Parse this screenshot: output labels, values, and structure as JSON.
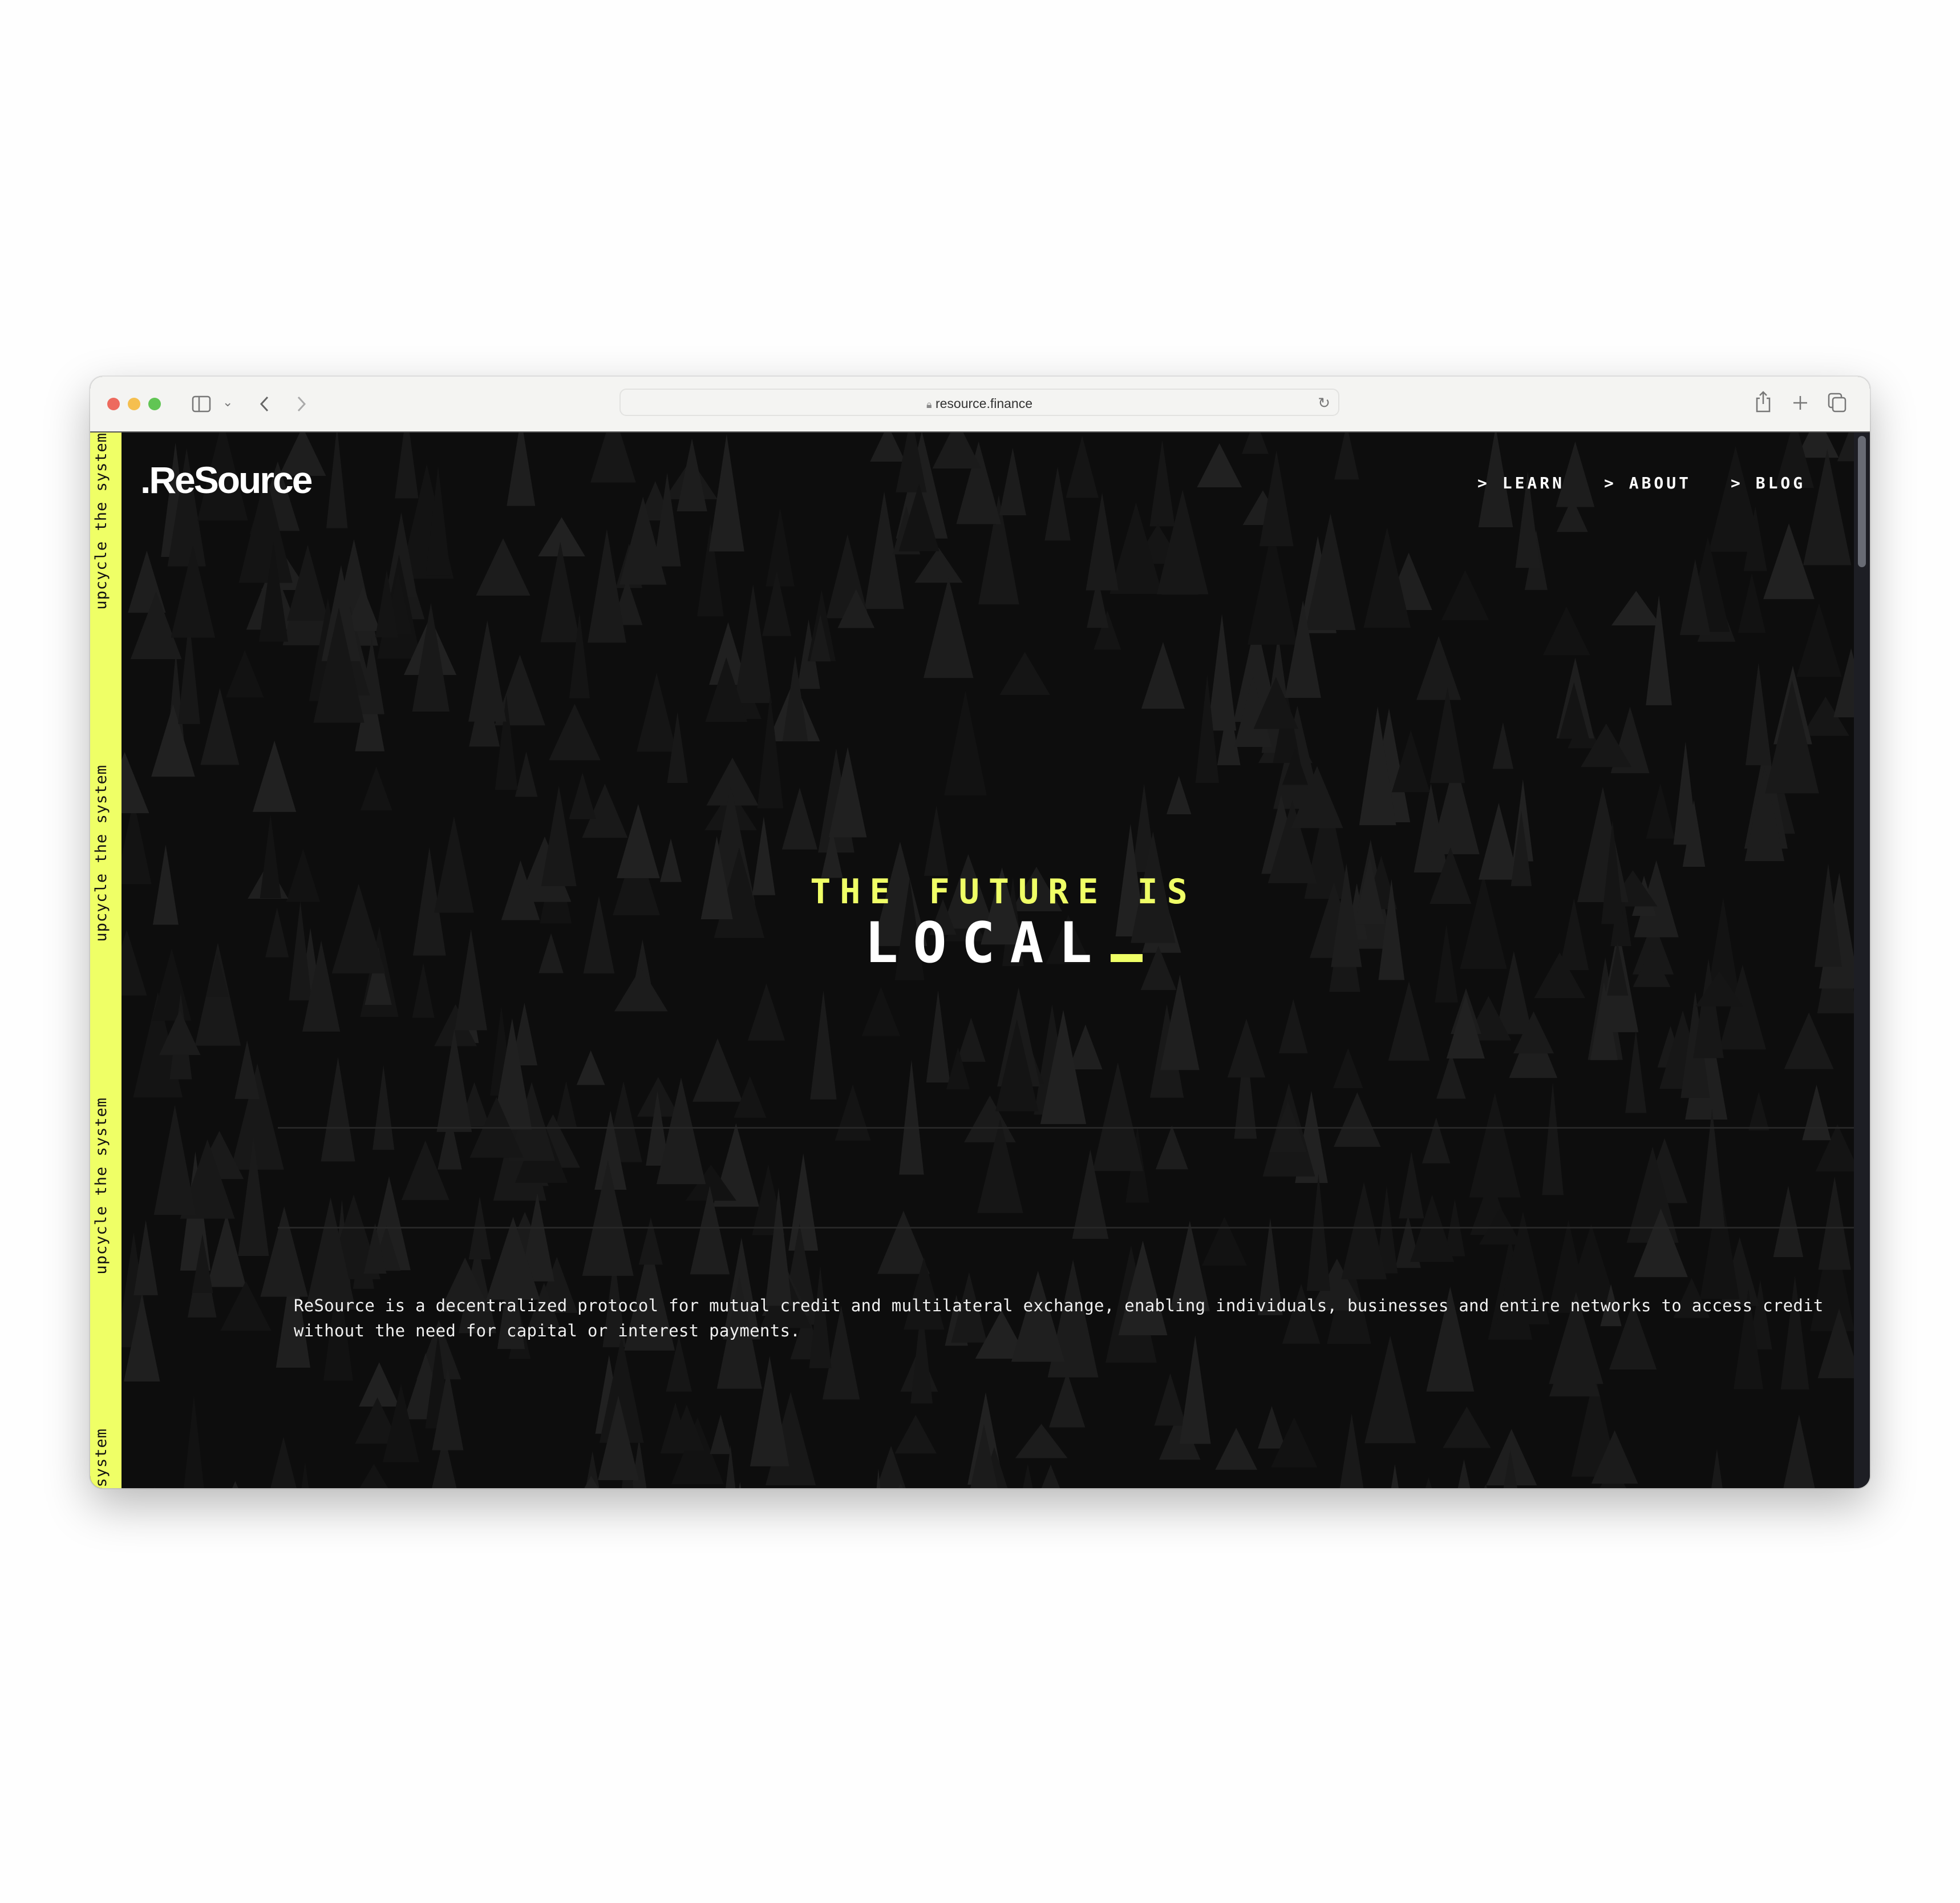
{
  "browser": {
    "url": "resource.finance",
    "traffic_lights": {
      "close": "#ed6a5e",
      "minimize": "#f5bf4f",
      "maximize": "#61c554"
    },
    "icons": [
      "sidebar-icon",
      "chevron-down-icon",
      "back-icon",
      "forward-icon",
      "lock-icon",
      "reload-icon",
      "share-icon",
      "new-tab-icon",
      "tabs-overview-icon"
    ]
  },
  "site": {
    "logo": ".ReSource",
    "nav": [
      {
        "prefix": ">",
        "label": "LEARN"
      },
      {
        "prefix": ">",
        "label": "ABOUT"
      },
      {
        "prefix": ">",
        "label": "BLOG"
      }
    ],
    "side_marquee": [
      "upcycle the system",
      "upcycle the system",
      "upcycle the system",
      "upcycle the system"
    ],
    "headline_top": "THE FUTURE IS",
    "headline_word": "LOCAL",
    "description": "ReSource is a decentralized protocol for mutual credit and multilateral exchange, enabling individuals, businesses and entire networks to access credit without the need for capital or interest payments.",
    "colors": {
      "accent": "#efff66",
      "background": "#0d0d0d",
      "text": "#ffffff"
    }
  }
}
